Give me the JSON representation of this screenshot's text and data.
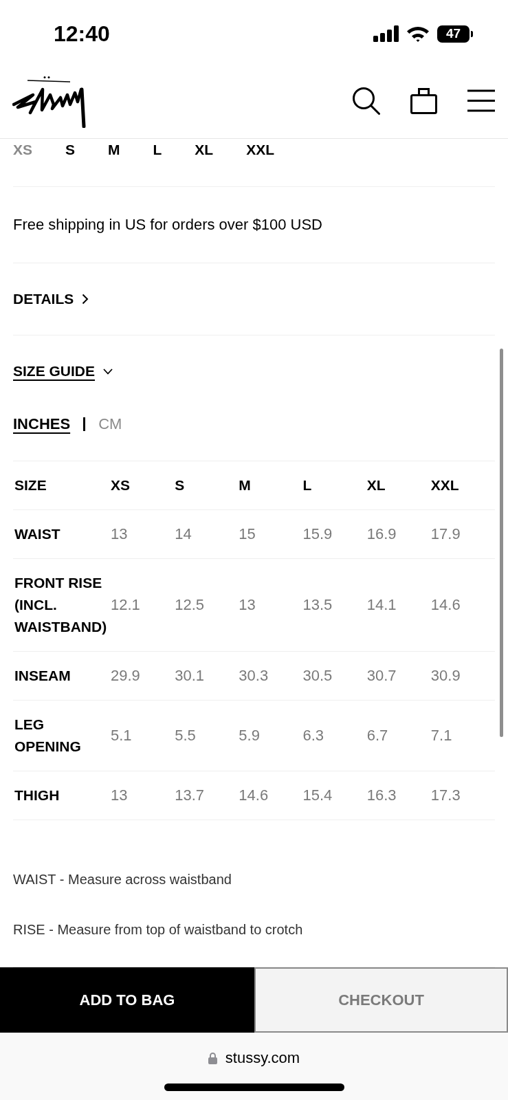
{
  "status_bar": {
    "time": "12:40",
    "battery": "47"
  },
  "size_options": [
    {
      "label": "XS",
      "available": false,
      "selected": false
    },
    {
      "label": "S",
      "available": true,
      "selected": false
    },
    {
      "label": "M",
      "available": true,
      "selected": false
    },
    {
      "label": "L",
      "available": true,
      "selected": false
    },
    {
      "label": "XL",
      "available": true,
      "selected": false
    },
    {
      "label": "XXL",
      "available": true,
      "selected": false
    }
  ],
  "shipping_note": "Free shipping in US for orders over $100 USD",
  "sections": [
    {
      "label": "DETAILS",
      "expanded": false
    },
    {
      "label": "SIZE GUIDE",
      "expanded": true,
      "units": [
        {
          "label": "INCHES",
          "selected": true
        },
        {
          "label": "CM",
          "selected": false
        }
      ],
      "table": {
        "columns": [
          "SIZE",
          "XS",
          "S",
          "M",
          "L",
          "XL",
          "XXL"
        ],
        "rows": [
          {
            "label": "WAIST",
            "values": [
              "13",
              "14",
              "15",
              "15.9",
              "16.9",
              "17.9"
            ]
          },
          {
            "label": "FRONT RISE (INCL. WAISTBAND)",
            "values": [
              "12.1",
              "12.5",
              "13",
              "13.5",
              "14.1",
              "14.6"
            ]
          },
          {
            "label": "INSEAM",
            "values": [
              "29.9",
              "30.1",
              "30.3",
              "30.5",
              "30.7",
              "30.9"
            ]
          },
          {
            "label": "LEG OPENING",
            "values": [
              "5.1",
              "5.5",
              "5.9",
              "6.3",
              "6.7",
              "7.1"
            ]
          },
          {
            "label": "THIGH",
            "values": [
              "13",
              "13.7",
              "14.6",
              "15.4",
              "16.3",
              "17.3"
            ]
          }
        ]
      },
      "notes": [
        "WAIST - Measure across waistband",
        "RISE - Measure from top of waistband to crotch"
      ]
    }
  ],
  "actions": [
    {
      "label": "ADD TO BAG",
      "kind": "primary"
    },
    {
      "label": "CHECKOUT",
      "kind": "secondary"
    }
  ],
  "address_bar": {
    "url": "stussy.com"
  }
}
